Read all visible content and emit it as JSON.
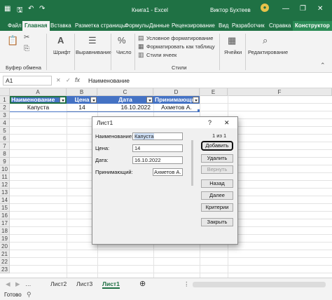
{
  "window": {
    "title": "Книга1 - Excel",
    "user": "Виктор Бухтеев",
    "accent": "#1f7144"
  },
  "tabs": [
    "Файл",
    "Главная",
    "Вставка",
    "Разметка страницы",
    "Формулы",
    "Данные",
    "Рецензирование",
    "Вид",
    "Разработчик",
    "Справка",
    "Конструктор"
  ],
  "ribbon": {
    "clipboard_label": "Буфер обмена",
    "font_label": "Шрифт",
    "align_label": "Выравнивание",
    "number_label": "Число",
    "cond_format": "Условное форматирование",
    "format_table": "Форматировать как таблицу",
    "cell_styles": "Стили ячеек",
    "styles_label": "Стили",
    "cells_label": "Ячейки",
    "editing_label": "Редактирование"
  },
  "formula_bar": {
    "name_box": "A1",
    "fx": "fx",
    "value": "Наименование"
  },
  "columns": [
    "A",
    "B",
    "C",
    "D",
    "E",
    "F"
  ],
  "rows": [
    "1",
    "2",
    "3",
    "4",
    "5",
    "6",
    "7",
    "8",
    "9",
    "10",
    "11",
    "12",
    "13",
    "14",
    "15",
    "16",
    "17",
    "18",
    "19",
    "20",
    "21",
    "22",
    "23"
  ],
  "table": {
    "headers": [
      "Наименование",
      "Цена",
      "Дата",
      "Принимающий"
    ],
    "row": [
      "Капуста",
      "14",
      "16.10.2022",
      "Ахметов А."
    ]
  },
  "dialog": {
    "title": "Лист1",
    "help": "?",
    "close": "✕",
    "record_counter": "1 из 1",
    "fields": [
      {
        "label": "Наименование:",
        "value": "Капуста"
      },
      {
        "label": "Цена:",
        "value": "14"
      },
      {
        "label": "Дата:",
        "value": "16.10.2022"
      },
      {
        "label": "Принимающий:",
        "value": "Ахметов А."
      }
    ],
    "buttons": {
      "add": "Добавить",
      "delete": "Удалить",
      "restore": "Вернуть",
      "prev": "Назад",
      "next": "Далее",
      "criteria": "Критерии",
      "close": "Закрыть"
    }
  },
  "sheets": [
    "Лист2",
    "Лист3",
    "Лист1"
  ],
  "active_sheet": "Лист1",
  "status": "Готово"
}
